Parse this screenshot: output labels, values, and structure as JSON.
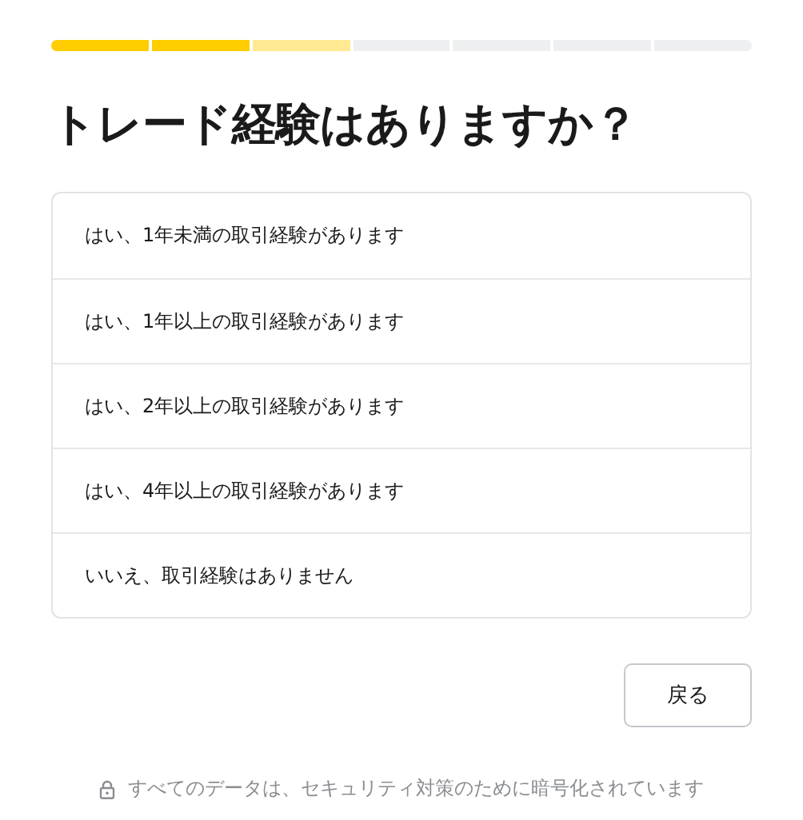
{
  "progress": [
    {
      "kind": "done"
    },
    {
      "kind": "done"
    },
    {
      "kind": "current"
    },
    {
      "kind": "todo"
    },
    {
      "kind": "todo"
    },
    {
      "kind": "todo"
    },
    {
      "kind": "todo"
    }
  ],
  "title": "トレード経験はありますか？",
  "options": [
    {
      "label": "はい、1年未満の取引経験があります"
    },
    {
      "label": "はい、1年以上の取引経験があります"
    },
    {
      "label": "はい、2年以上の取引経験があります"
    },
    {
      "label": "はい、4年以上の取引経験があります"
    },
    {
      "label": "いいえ、取引経験はありません"
    }
  ],
  "back_button": "戻る",
  "footer": "すべてのデータは、セキュリティ対策のために暗号化されています"
}
